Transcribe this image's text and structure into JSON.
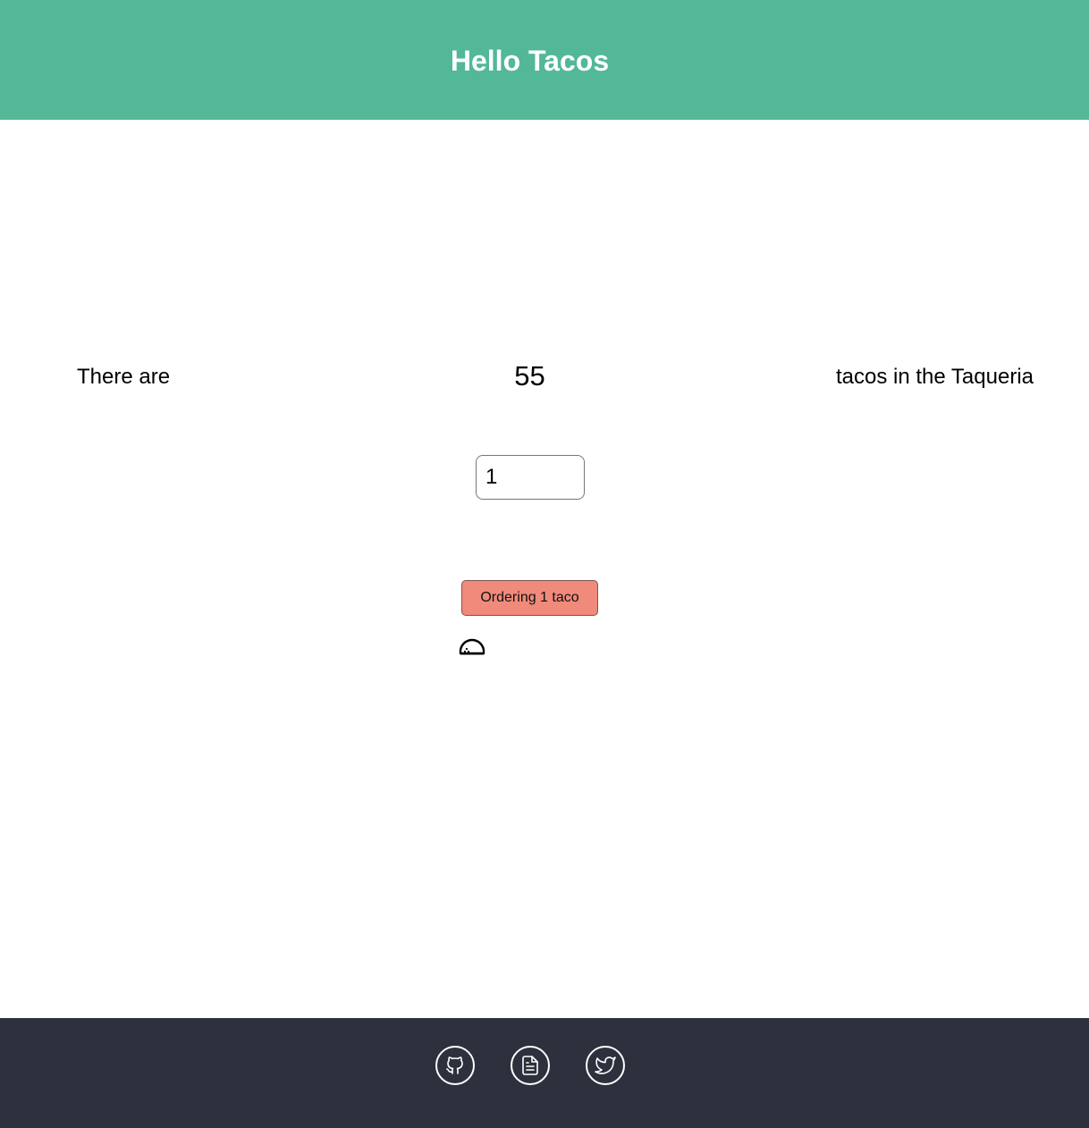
{
  "header": {
    "title": "Hello Tacos",
    "background_color": "#52b898"
  },
  "inventory": {
    "prefix": "There are",
    "count": "55",
    "suffix": "tacos in the Taqueria"
  },
  "order": {
    "quantity_value": "1",
    "button_label": "Ordering 1 taco",
    "button_color": "#f08a7a",
    "taco_icon": "taco-icon"
  },
  "footer": {
    "background_color": "#2d313d",
    "links": [
      {
        "icon": "github-icon"
      },
      {
        "icon": "document-icon"
      },
      {
        "icon": "twitter-icon"
      }
    ]
  }
}
